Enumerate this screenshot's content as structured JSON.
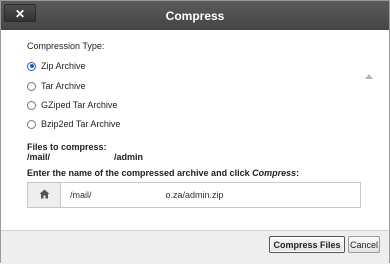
{
  "window": {
    "title": "Compress",
    "close_label": "✕"
  },
  "compression": {
    "heading": "Compression Type:",
    "options": [
      {
        "label": "Zip Archive",
        "checked": true
      },
      {
        "label": "Tar Archive",
        "checked": false
      },
      {
        "label": "GZiped Tar Archive",
        "checked": false
      },
      {
        "label": "Bzip2ed Tar Archive",
        "checked": false
      }
    ]
  },
  "files": {
    "heading": "Files to compress:",
    "path_start": "/mail/",
    "path_end": "/admin"
  },
  "archive": {
    "instruction_prefix": "Enter the name of the compressed archive and click ",
    "instruction_em": "Compress",
    "instruction_suffix": ":",
    "input_start": "/mail/",
    "input_end": "o.za/admin.zip"
  },
  "buttons": {
    "compress": "Compress Files",
    "cancel": "Cancel"
  },
  "icons": {
    "close": "close-icon",
    "home": "home-icon"
  }
}
